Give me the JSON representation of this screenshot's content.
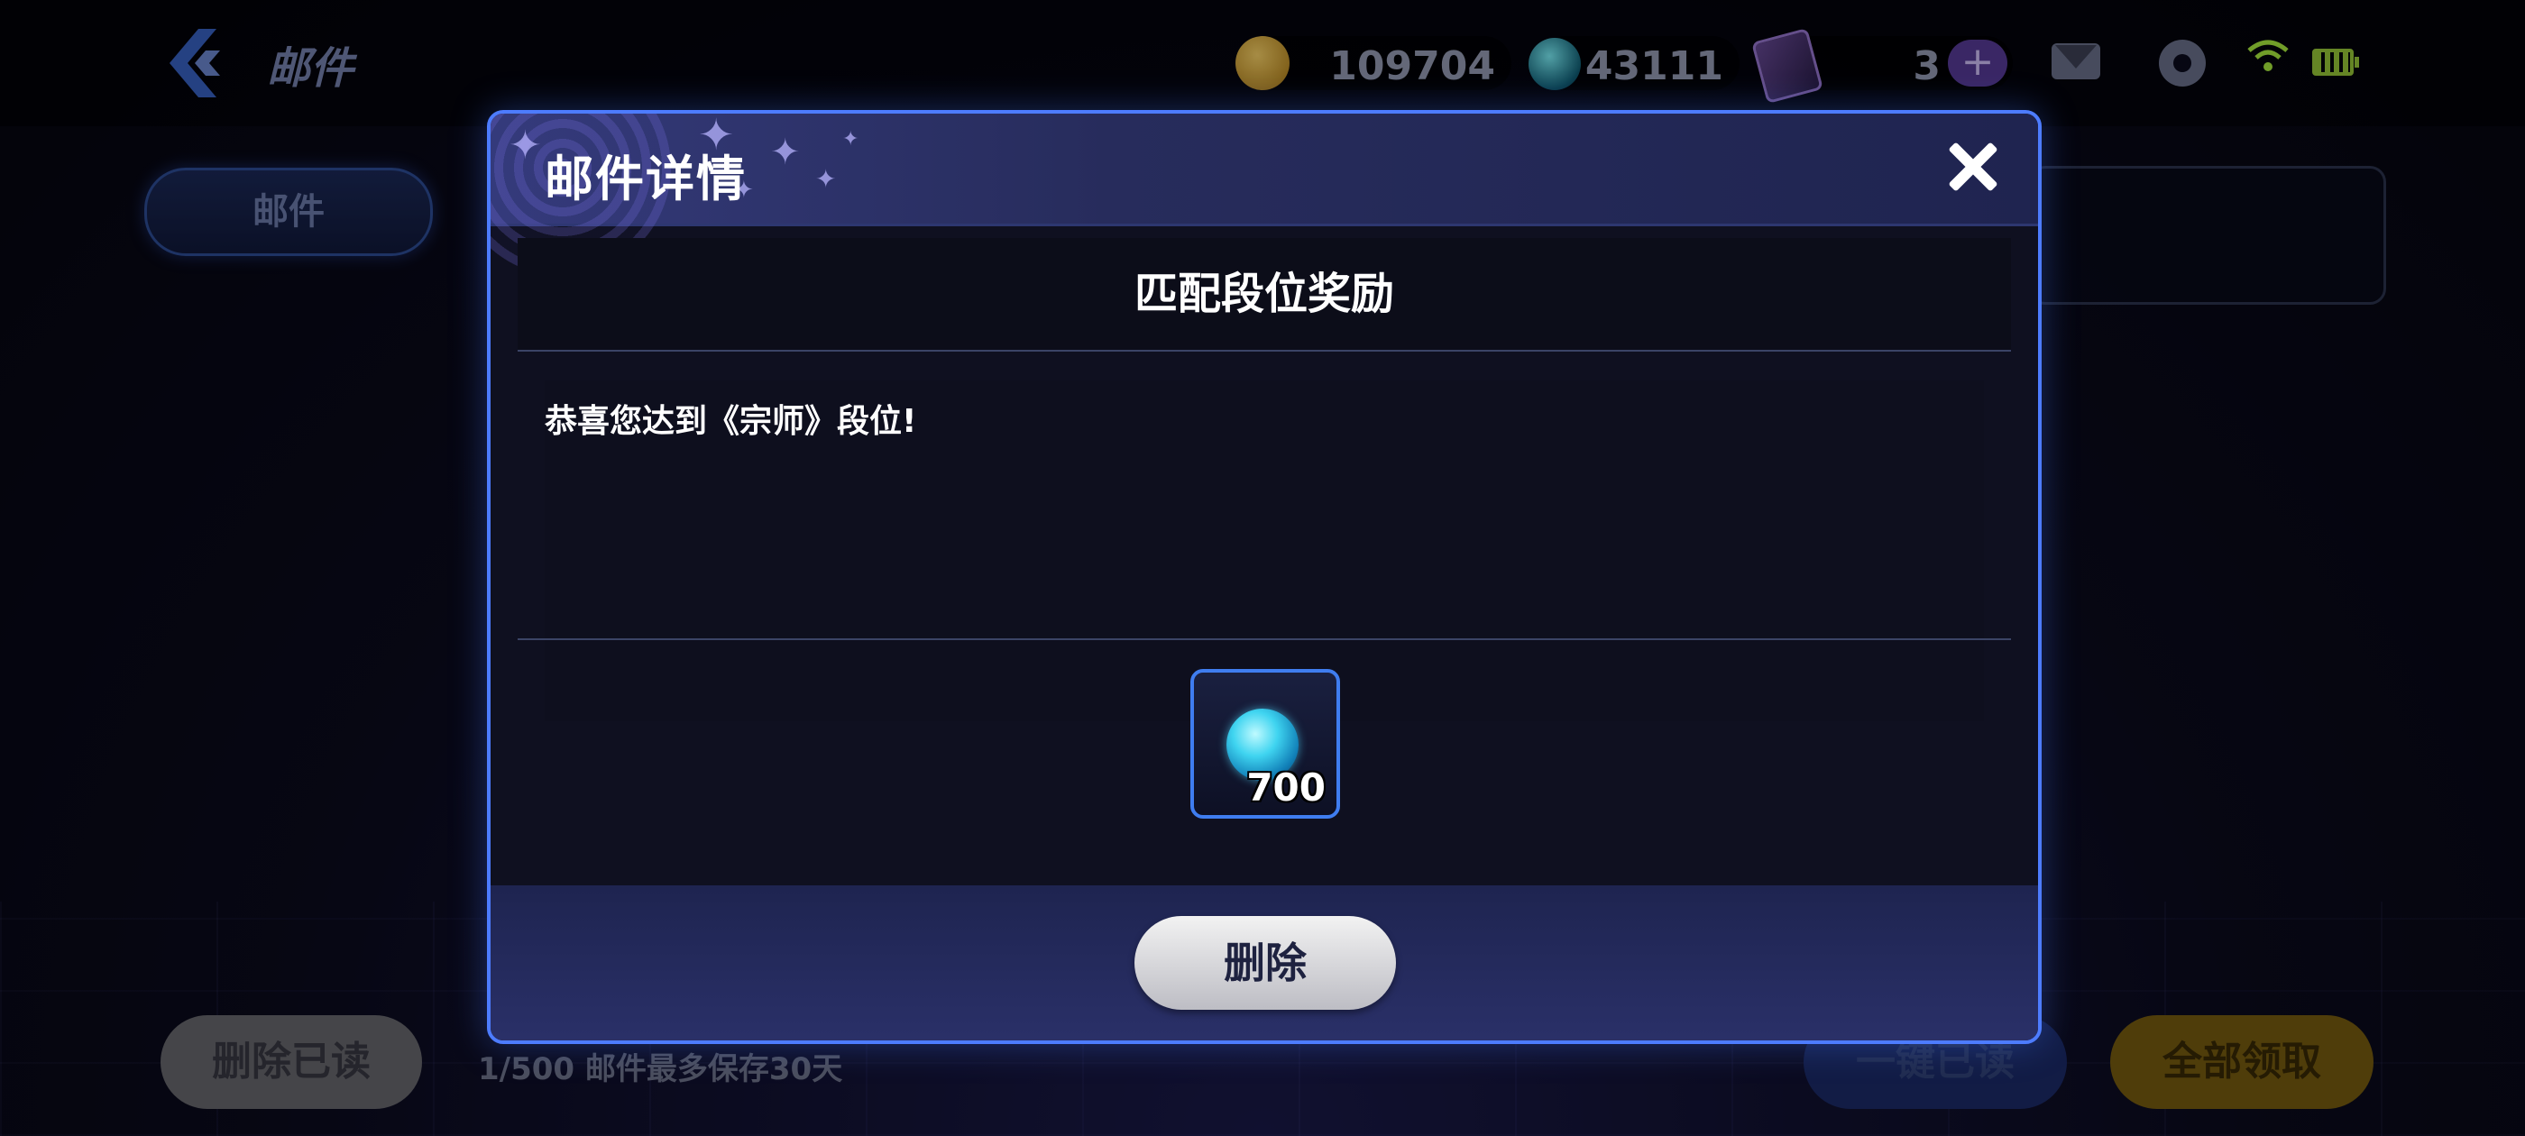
{
  "header": {
    "title": "邮件",
    "currencies": [
      {
        "icon": "gold-coin-icon",
        "value": "109704"
      },
      {
        "icon": "gem-icon",
        "value": "43111"
      },
      {
        "icon": "ticket-icon",
        "value": "3"
      }
    ],
    "add_label": "+"
  },
  "sidebar": {
    "tab_label": "邮件"
  },
  "footer": {
    "delete_read_label": "删除已读",
    "mail_count": "1/500 邮件最多保存30天",
    "mark_all_read_label": "一键已读",
    "claim_all_label": "全部领取"
  },
  "modal": {
    "title": "邮件详情",
    "subject": "匹配段位奖励",
    "body": "恭喜您达到《宗师》段位!",
    "reward": {
      "icon": "gem-icon",
      "quantity": "700"
    },
    "delete_label": "删除"
  },
  "colors": {
    "accent_blue": "#4d7cff",
    "wifi_green": "#aef240",
    "claim_gold": "#7a5e10"
  }
}
